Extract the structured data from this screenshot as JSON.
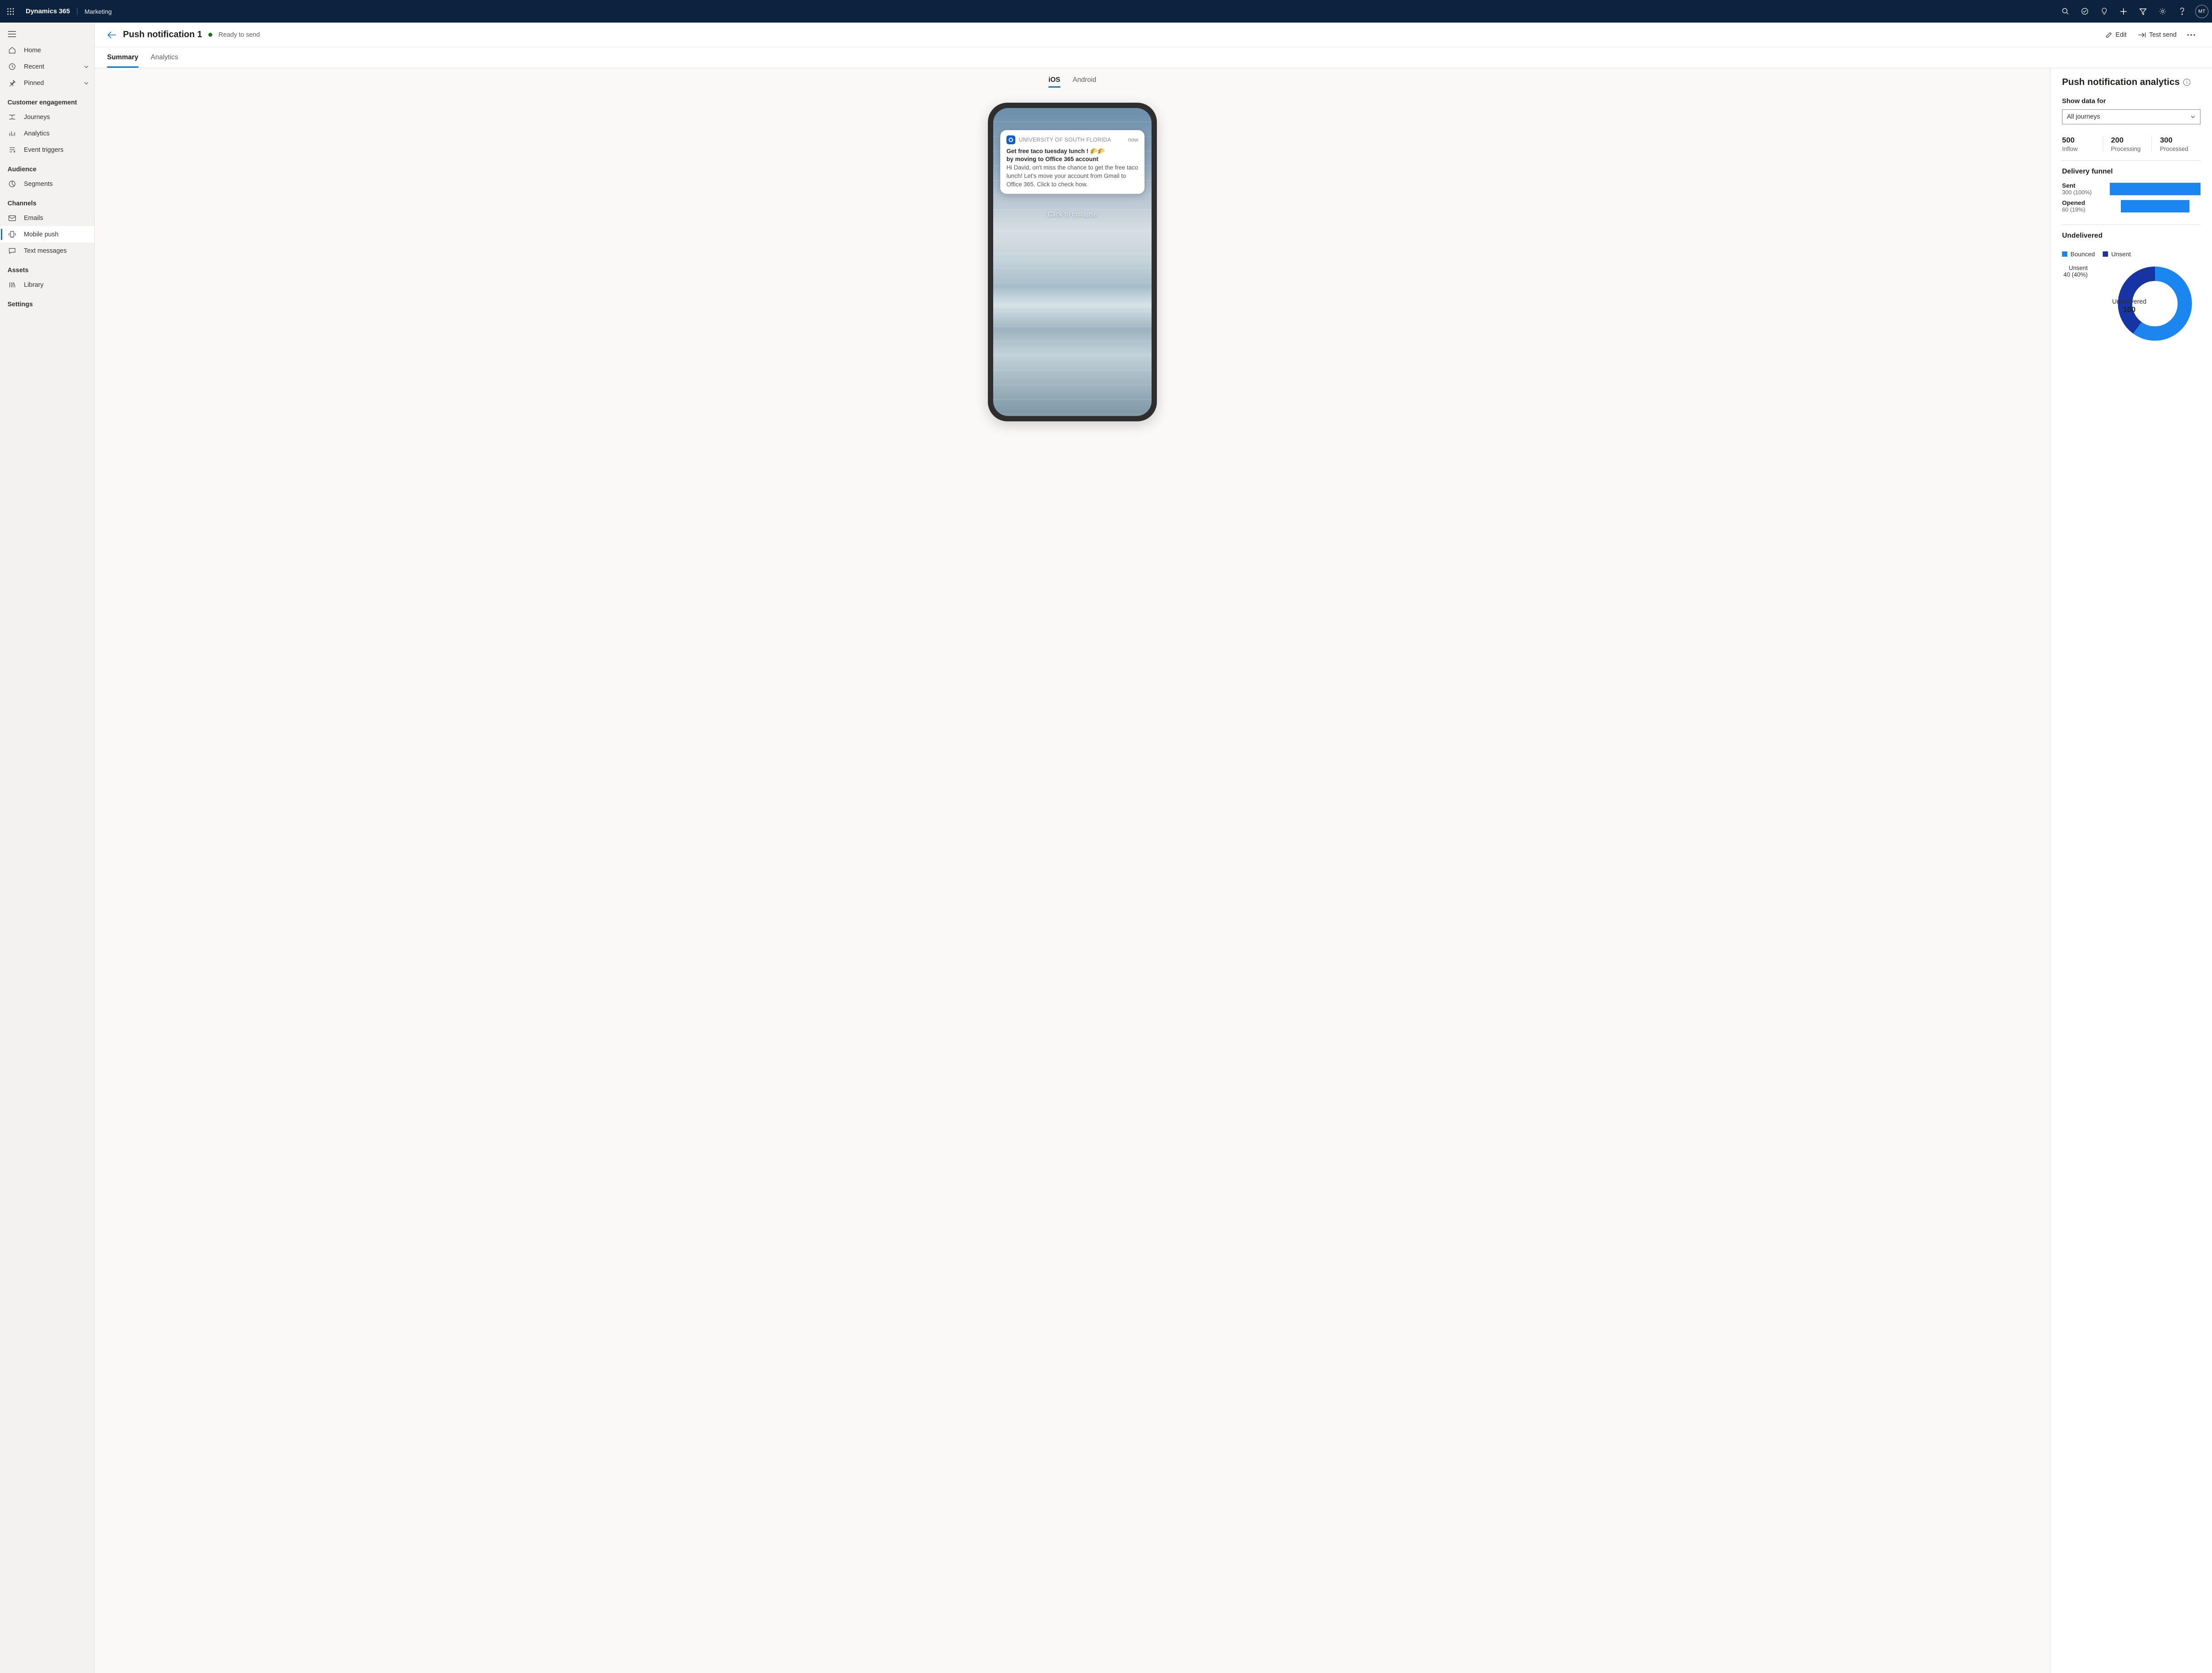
{
  "topbar": {
    "app_name": "Dynamics 365",
    "module": "Marketing",
    "avatar_initials": "MT"
  },
  "sidebar": {
    "top": [
      {
        "label": "Home"
      },
      {
        "label": "Recent",
        "expandable": true
      },
      {
        "label": "Pinned",
        "expandable": true
      }
    ],
    "groups": [
      {
        "heading": "Customer engagement",
        "items": [
          {
            "label": "Journeys"
          },
          {
            "label": "Analytics"
          },
          {
            "label": "Event triggers"
          }
        ]
      },
      {
        "heading": "Audience",
        "items": [
          {
            "label": "Segments"
          }
        ]
      },
      {
        "heading": "Channels",
        "items": [
          {
            "label": "Emails"
          },
          {
            "label": "Mobile push",
            "active": true
          },
          {
            "label": "Text messages"
          }
        ]
      },
      {
        "heading": "Assets",
        "items": [
          {
            "label": "Library"
          }
        ]
      },
      {
        "heading": "Settings",
        "items": []
      }
    ]
  },
  "header": {
    "title": "Push notification 1",
    "status": "Ready to send",
    "actions": {
      "edit": "Edit",
      "test_send": "Test send"
    }
  },
  "tabs": {
    "summary": "Summary",
    "analytics": "Analytics"
  },
  "platform_tabs": {
    "ios": "iOS",
    "android": "Android"
  },
  "notification_preview": {
    "app_name": "UNIVERSITY OF SOUTH FLORIDA",
    "time": "now",
    "title_line1": "Get free taco tuesday lunch ! 🌮🌮",
    "title_line2": "by moving to Office 365 account",
    "body": "Hi David, on't miss the chance to get the free taco lunch! Let's move your account from Gmail to Office 365. Click to check how.",
    "collapse_label": "Click to collapse"
  },
  "analytics_panel": {
    "title": "Push notification analytics",
    "show_data_label": "Show data for",
    "filter_value": "All journeys",
    "kpis": [
      {
        "value": "500",
        "label": "Inflow"
      },
      {
        "value": "200",
        "label": "Processing"
      },
      {
        "value": "300",
        "label": "Processed"
      }
    ],
    "delivery_funnel": {
      "title": "Delivery funnel",
      "rows": [
        {
          "label": "Sent",
          "sub": "300 (100%)",
          "pct": 100
        },
        {
          "label": "Opened",
          "sub": "60 (19%)",
          "pct": 75
        }
      ]
    },
    "undelivered": {
      "title": "Undelivered",
      "legend": [
        {
          "label": "Bounced",
          "color": "#1b86ef"
        },
        {
          "label": "Unsent",
          "color": "#1634a3"
        }
      ],
      "slice_label": "Unsent",
      "slice_sub": "40 (40%)",
      "center_label": "Undelivered",
      "center_value": "100"
    }
  },
  "chart_data": [
    {
      "type": "bar",
      "title": "Delivery funnel",
      "series": [
        {
          "name": "Sent",
          "values": [
            300
          ],
          "pct": 100
        },
        {
          "name": "Opened",
          "values": [
            60
          ],
          "pct": 19
        }
      ],
      "xlabel": "",
      "ylabel": "",
      "ylim": [
        0,
        300
      ]
    },
    {
      "type": "pie",
      "title": "Undelivered",
      "total_label": "Undelivered",
      "total_value": 100,
      "slices": [
        {
          "name": "Unsent",
          "value": 40,
          "pct": 40,
          "color": "#1634a3"
        },
        {
          "name": "Bounced",
          "value": 60,
          "pct": 60,
          "color": "#1b86ef"
        }
      ]
    }
  ]
}
